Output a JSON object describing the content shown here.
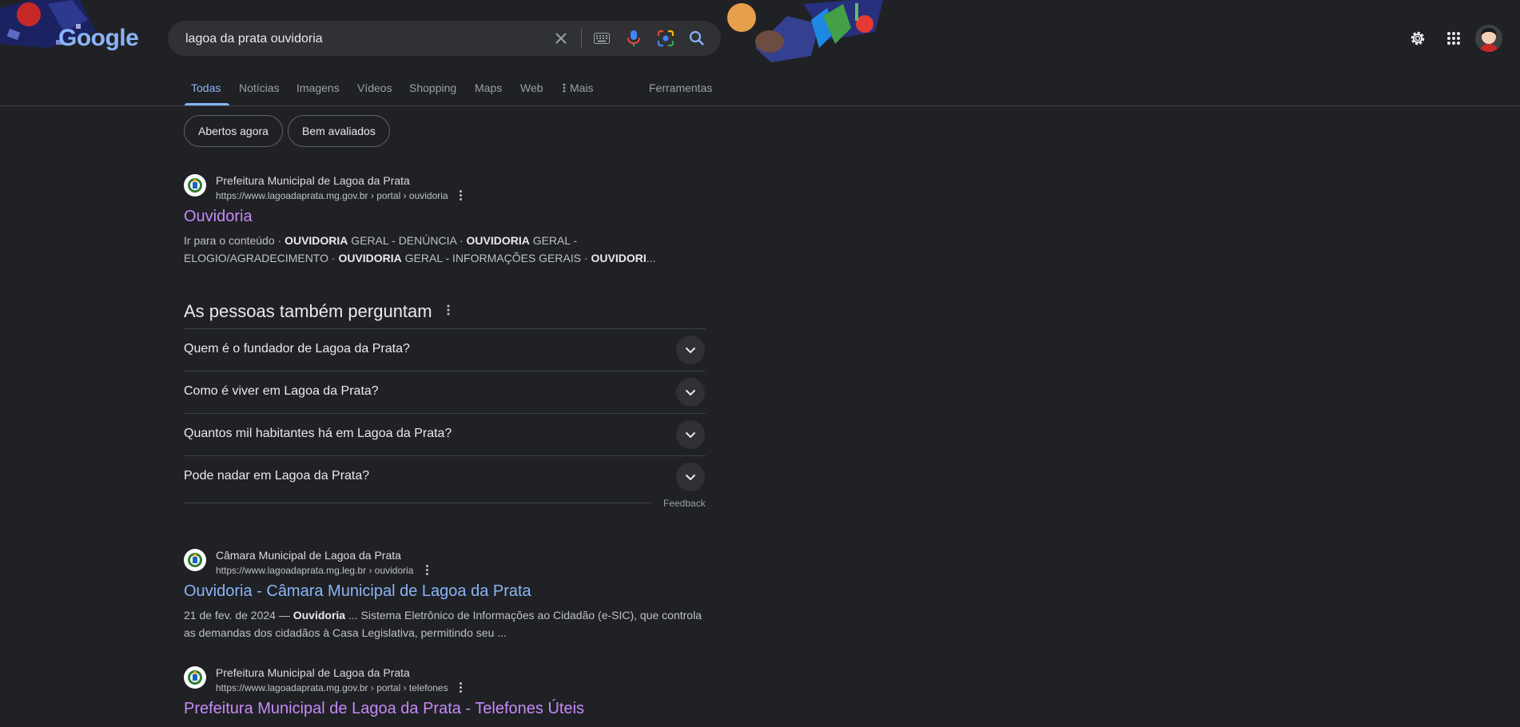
{
  "search": {
    "query": "lagoa da prata ouvidoria",
    "logo_text": "Google"
  },
  "icons": {
    "clear": "close-icon",
    "keyboard": "keyboard-icon",
    "voice": "microphone-icon",
    "lens": "lens-camera-icon",
    "search": "search-icon",
    "settings": "gear-icon",
    "apps": "apps-grid-icon",
    "expand": "chevron-down-icon",
    "more": "more-vert-icon"
  },
  "colors": {
    "background": "#202124",
    "link_visited": "#c58af9",
    "link_unvisited": "#8ab4f8",
    "text_primary": "#e8eaed",
    "text_secondary": "#bdc1c6"
  },
  "tabs": [
    {
      "label": "Todas",
      "active": true
    },
    {
      "label": "Notícias"
    },
    {
      "label": "Imagens"
    },
    {
      "label": "Vídeos"
    },
    {
      "label": "Shopping"
    },
    {
      "label": "Maps"
    },
    {
      "label": "Web"
    },
    {
      "label": "Mais"
    },
    {
      "label": "Ferramentas"
    }
  ],
  "chips": [
    "Abertos agora",
    "Bem avaliados"
  ],
  "results": [
    {
      "site_name": "Prefeitura Municipal de Lagoa da Prata",
      "url": "https://www.lagoadaprata.mg.gov.br › portal › ouvidoria",
      "title": "Ouvidoria",
      "visited": true,
      "snippet": [
        {
          "t": "Ir para o conteúdo · "
        },
        {
          "t": "OUVIDORIA",
          "b": true
        },
        {
          "t": " GERAL - DENÚNCIA · "
        },
        {
          "t": "OUVIDORIA",
          "b": true
        },
        {
          "t": " GERAL - ELOGIO/AGRADECIMENTO · "
        },
        {
          "t": "OUVIDORIA",
          "b": true
        },
        {
          "t": " GERAL - INFORMAÇÕES GERAIS · "
        },
        {
          "t": "OUVIDORI",
          "b": true
        },
        {
          "t": "..."
        }
      ]
    },
    {
      "site_name": "Câmara Municipal de Lagoa da Prata",
      "url": "https://www.lagoadaprata.mg.leg.br › ouvidoria",
      "title": "Ouvidoria - Câmara Municipal de Lagoa da Prata",
      "visited": false,
      "snippet": [
        {
          "t": "21 de fev. de 2024 — "
        },
        {
          "t": "Ouvidoria",
          "b": true
        },
        {
          "t": " ... Sistema Eletrônico de Informações ao Cidadão (e-SIC), que controla as demandas dos cidadãos à Casa Legislativa, permitindo seu ..."
        }
      ]
    },
    {
      "site_name": "Prefeitura Municipal de Lagoa da Prata",
      "url": "https://www.lagoadaprata.mg.gov.br › portal › telefones",
      "title": "Prefeitura Municipal de Lagoa da Prata - Telefones Úteis",
      "visited": true,
      "snippet": []
    }
  ],
  "paa": {
    "title": "As pessoas também perguntam",
    "questions": [
      "Quem é o fundador de Lagoa da Prata?",
      "Como é viver em Lagoa da Prata?",
      "Quantos mil habitantes há em Lagoa da Prata?",
      "Pode nadar em Lagoa da Prata?"
    ],
    "feedback": "Feedback"
  }
}
